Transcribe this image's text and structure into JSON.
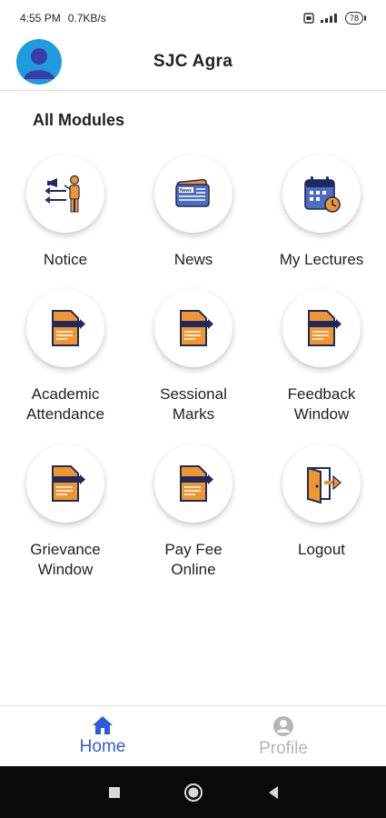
{
  "status_bar": {
    "time": "4:55 PM",
    "network_speed": "0.7KB/s",
    "battery_level": "78",
    "icons": [
      "sim-icon",
      "signal-icon",
      "battery-icon"
    ]
  },
  "header": {
    "title": "SJC Agra",
    "avatar_icon": "user-avatar-icon"
  },
  "section_title": "All Modules",
  "modules": [
    {
      "label": "Notice",
      "icon": "presentation-icon"
    },
    {
      "label": "News",
      "icon": "newspaper-icon"
    },
    {
      "label": "My Lectures",
      "icon": "calendar-icon"
    },
    {
      "label": "Academic\nAttendance",
      "icon": "document-icon"
    },
    {
      "label": "Sessional\nMarks",
      "icon": "document-icon"
    },
    {
      "label": "Feedback\nWindow",
      "icon": "document-icon"
    },
    {
      "label": "Grievance\nWindow",
      "icon": "document-icon"
    },
    {
      "label": "Pay Fee\nOnline",
      "icon": "document-icon"
    },
    {
      "label": "Logout",
      "icon": "logout-door-icon"
    }
  ],
  "bottom_nav": {
    "items": [
      {
        "label": "Home",
        "icon": "home-icon",
        "active": true
      },
      {
        "label": "Profile",
        "icon": "profile-icon",
        "active": false
      }
    ],
    "active_color": "#2f5ae0",
    "inactive_color": "#b5b5b5"
  },
  "colors": {
    "accent": "#2f5ae0",
    "icon_orange": "#f0962e",
    "icon_navy": "#1f2b5e",
    "icon_blue": "#4d6dbf",
    "avatar_blue": "#1f9bde"
  }
}
